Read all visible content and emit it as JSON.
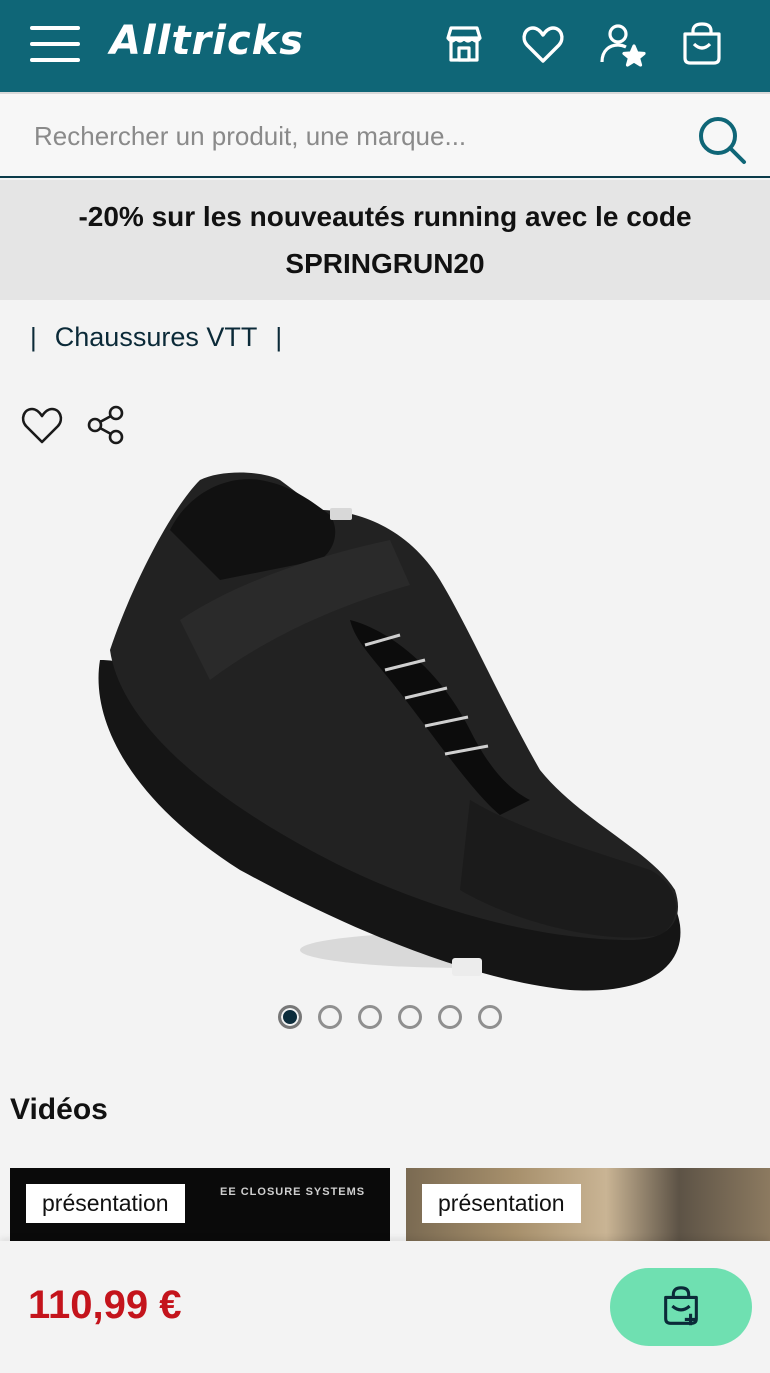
{
  "header": {
    "logo_text": "Alltricks",
    "background_color": "#0f6677",
    "icons": [
      "menu-icon",
      "store-icon",
      "heart-icon",
      "account-icon",
      "cart-icon"
    ]
  },
  "search": {
    "placeholder": "Rechercher un produit, une marque..."
  },
  "promo": {
    "line1": "-20% sur les nouveautés running avec le code",
    "line2": "SPRINGRUN20"
  },
  "breadcrumb": {
    "separator": "|",
    "item": "Chaussures VTT"
  },
  "gallery": {
    "image_count": 6,
    "active_index": 0
  },
  "videos": {
    "title": "Vidéos",
    "items": [
      {
        "tag": "présentation",
        "caption": "EE CLOSURE SYSTEMS"
      },
      {
        "tag": "présentation"
      }
    ]
  },
  "footer": {
    "price": "110,99 €",
    "price_color": "#c4141c",
    "cart_button_color": "#6fe0b1"
  }
}
